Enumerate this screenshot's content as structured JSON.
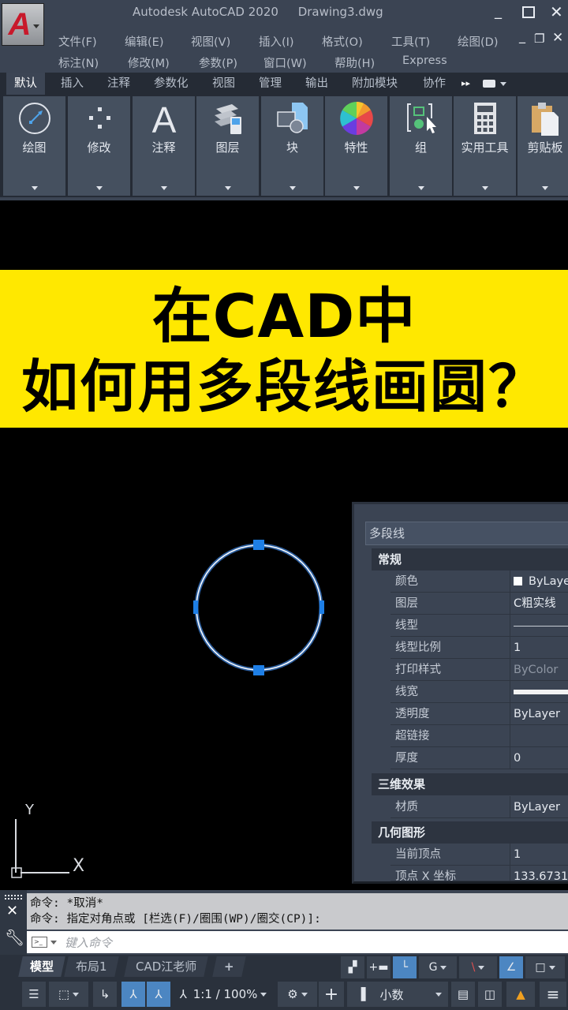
{
  "app": {
    "title": "Autodesk AutoCAD 2020",
    "document": "Drawing3.dwg",
    "logo_letter": "A"
  },
  "menubar": {
    "row1": [
      "文件(F)",
      "编辑(E)",
      "视图(V)",
      "插入(I)",
      "格式(O)",
      "工具(T)",
      "绘图(D)"
    ],
    "row2": [
      "标注(N)",
      "修改(M)",
      "参数(P)",
      "窗口(W)",
      "帮助(H)",
      "Express"
    ]
  },
  "ribbon": {
    "tabs": [
      "默认",
      "插入",
      "注释",
      "参数化",
      "视图",
      "管理",
      "输出",
      "附加模块",
      "协作"
    ],
    "active_tab": "默认",
    "more_icon": "▸▸",
    "panels": [
      {
        "label": "绘图",
        "icon": "circle-radius-icon"
      },
      {
        "label": "修改",
        "icon": "move-dots-icon"
      },
      {
        "label": "注释",
        "icon": "text-A-icon"
      },
      {
        "label": "图层",
        "icon": "layers-icon"
      },
      {
        "label": "块",
        "icon": "block-icon"
      },
      {
        "label": "特性",
        "icon": "color-wheel-icon"
      },
      {
        "label": "组",
        "icon": "group-icon"
      },
      {
        "label": "实用工具",
        "icon": "calculator-icon"
      },
      {
        "label": "剪贴板",
        "icon": "clipboard-icon"
      }
    ]
  },
  "banner": {
    "line1": "在CAD中",
    "line2": "如何用多段线画圆？",
    "bg_color": "#ffe800"
  },
  "drawing": {
    "selected_object": "circle-polyline",
    "grip_color": "#1e7fe6",
    "ucs": {
      "x_label": "X",
      "y_label": "Y"
    }
  },
  "properties": {
    "object_type": "多段线",
    "categories": [
      {
        "name": "常规",
        "rows": [
          {
            "key": "颜色",
            "value": "ByLayer",
            "swatch": "#ffffff"
          },
          {
            "key": "图层",
            "value": "C粗实线"
          },
          {
            "key": "线型",
            "value": "",
            "linetype": "continuous"
          },
          {
            "key": "线型比例",
            "value": "1"
          },
          {
            "key": "打印样式",
            "value": "ByColor",
            "dim": true
          },
          {
            "key": "线宽",
            "value": "",
            "lineweight": "thick"
          },
          {
            "key": "透明度",
            "value": "ByLayer"
          },
          {
            "key": "超链接",
            "value": ""
          },
          {
            "key": "厚度",
            "value": "0"
          }
        ]
      },
      {
        "name": "三维效果",
        "rows": [
          {
            "key": "材质",
            "value": "ByLayer"
          }
        ]
      },
      {
        "name": "几何图形",
        "rows": [
          {
            "key": "当前顶点",
            "value": "1"
          },
          {
            "key": "顶点 X 坐标",
            "value": "133.6731"
          }
        ]
      }
    ]
  },
  "command": {
    "history": [
      "命令: *取消*",
      "命令: 指定对角点或 [栏选(F)/圈围(WP)/圈交(CP)]:"
    ],
    "placeholder": "键入命令"
  },
  "layout_tabs": {
    "tabs": [
      "模型",
      "布局1",
      "CAD江老师"
    ],
    "active": "模型",
    "add": "+"
  },
  "statusbar": {
    "scale": "1:1 / 100%",
    "units": "小数"
  }
}
